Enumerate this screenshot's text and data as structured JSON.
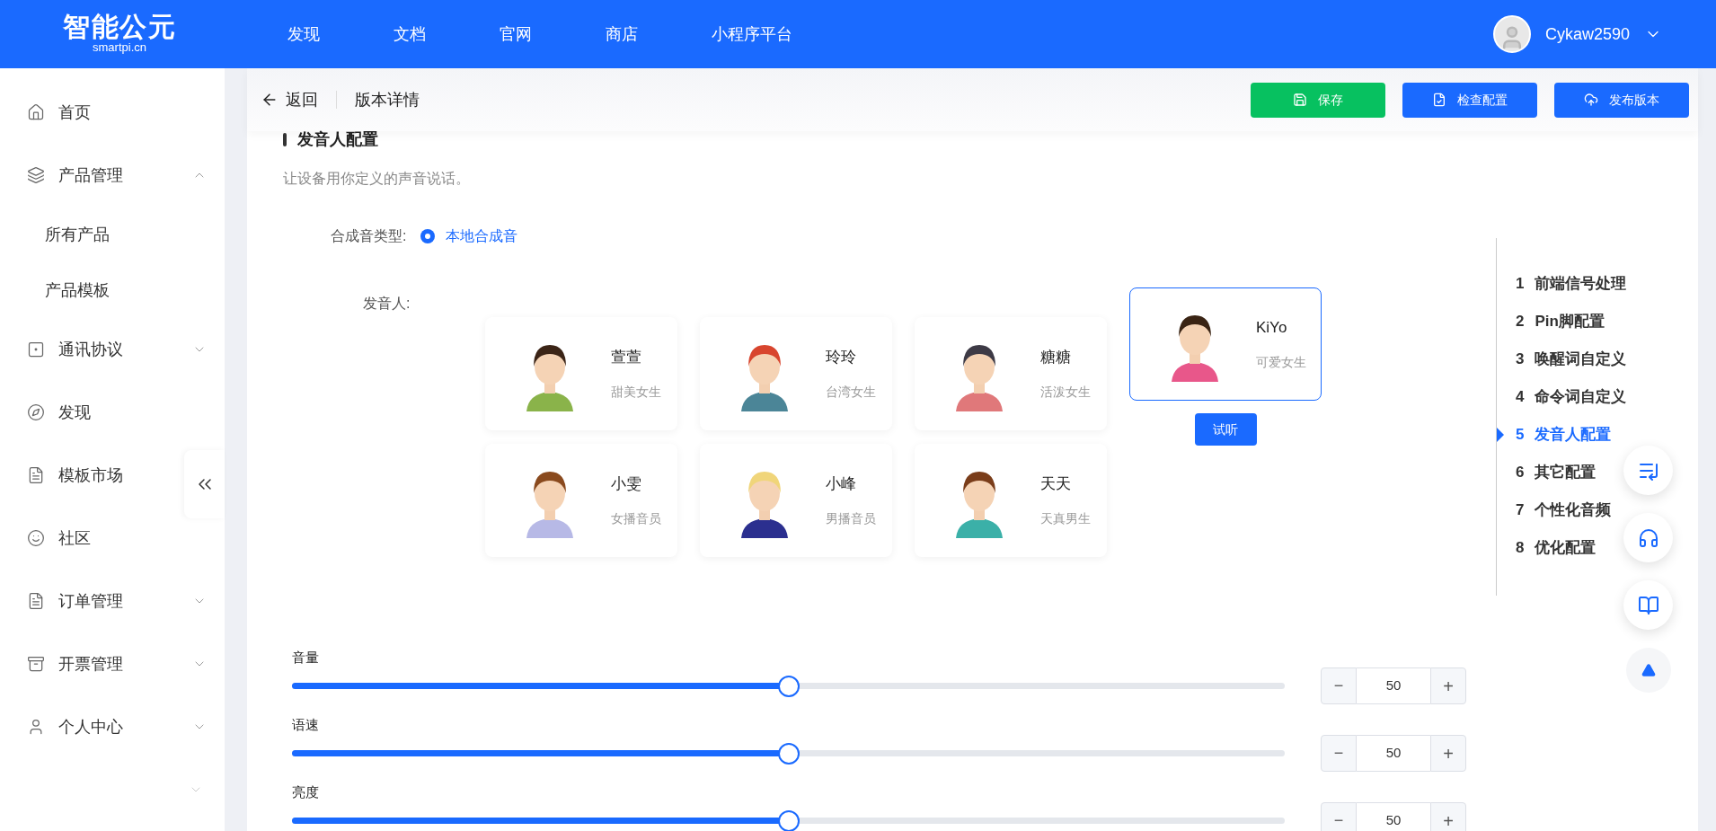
{
  "header": {
    "logo": "智能公元",
    "logo_sub": "smartpi.cn",
    "nav": [
      "发现",
      "文档",
      "官网",
      "商店",
      "小程序平台"
    ],
    "user": "Cykaw2590"
  },
  "sidebar": {
    "items": [
      {
        "label": "首页"
      },
      {
        "label": "产品管理",
        "expanded": true,
        "children": [
          {
            "label": "所有产品"
          },
          {
            "label": "产品模板"
          }
        ]
      },
      {
        "label": "通讯协议",
        "expanded": false
      },
      {
        "label": "发现"
      },
      {
        "label": "模板市场"
      },
      {
        "label": "社区"
      },
      {
        "label": "订单管理",
        "expanded": false
      },
      {
        "label": "开票管理",
        "expanded": false
      },
      {
        "label": "个人中心",
        "expanded": false
      }
    ]
  },
  "toolbar": {
    "back": "返回",
    "title": "版本详情",
    "buttons": [
      {
        "label": "保存",
        "kind": "save"
      },
      {
        "label": "检查配置",
        "kind": "check"
      },
      {
        "label": "发布版本",
        "kind": "publish"
      }
    ]
  },
  "section": {
    "title": "发音人配置",
    "description": "让设备用你定义的声音说话。",
    "synth_label": "合成音类型:",
    "synth_options": [
      {
        "label": "本地合成音",
        "selected": true
      }
    ],
    "speaker_label": "发音人:",
    "preview_button": "试听"
  },
  "voices": [
    {
      "name": "萱萱",
      "desc": "甜美女生",
      "selected": false
    },
    {
      "name": "玲玲",
      "desc": "台湾女生",
      "selected": false
    },
    {
      "name": "糖糖",
      "desc": "活泼女生",
      "selected": false
    },
    {
      "name": "小雯",
      "desc": "女播音员",
      "selected": false
    },
    {
      "name": "小峰",
      "desc": "男播音员",
      "selected": false
    },
    {
      "name": "天天",
      "desc": "天真男生",
      "selected": false
    },
    {
      "name": "KiYo",
      "desc": "可爱女生",
      "selected": true
    }
  ],
  "sliders": [
    {
      "label": "音量",
      "level": 0.5,
      "value": "50",
      "minus": "−",
      "plus": "+"
    },
    {
      "label": "语速",
      "level": 0.5,
      "value": "50",
      "minus": "−",
      "plus": "+"
    },
    {
      "label": "亮度",
      "level": 0.5,
      "value": "50",
      "minus": "−",
      "plus": "+"
    }
  ],
  "anchors": [
    {
      "number": "1",
      "label": "前端信号处理",
      "selected": false
    },
    {
      "number": "2",
      "label": "Pin脚配置",
      "selected": false
    },
    {
      "number": "3",
      "label": "唤醒词自定义",
      "selected": false
    },
    {
      "number": "4",
      "label": "命令词自定义",
      "selected": false
    },
    {
      "number": "5",
      "label": "发音人配置",
      "selected": true
    },
    {
      "number": "6",
      "label": "其它配置",
      "selected": false
    },
    {
      "number": "7",
      "label": "个性化音频",
      "selected": false
    },
    {
      "number": "8",
      "label": "优化配置",
      "selected": false
    }
  ]
}
